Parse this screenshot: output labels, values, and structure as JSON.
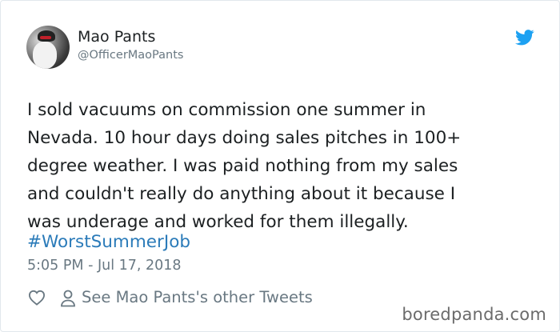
{
  "author": {
    "name": "Mao Pants",
    "handle": "@OfficerMaoPants"
  },
  "tweet": {
    "text": "I sold vacuums on commission one summer in\nNevada. 10 hour days doing sales pitches in 100+\ndegree weather. I was paid nothing from my sales\nand couldn't really do anything about it because I\nwas underage and worked for them illegally.",
    "hashtag": "#WorstSummerJob",
    "timestamp": "5:05 PM - Jul 17, 2018"
  },
  "actions": {
    "other_tweets_label": "See Mao Pants's other Tweets"
  },
  "watermark": "boredpanda.com",
  "colors": {
    "link": "#2b7bb9",
    "twitter_blue": "#1da1f2",
    "muted": "#697882",
    "text": "#1c2022"
  },
  "icons": [
    "twitter-bird-icon",
    "heart-icon",
    "person-icon"
  ]
}
